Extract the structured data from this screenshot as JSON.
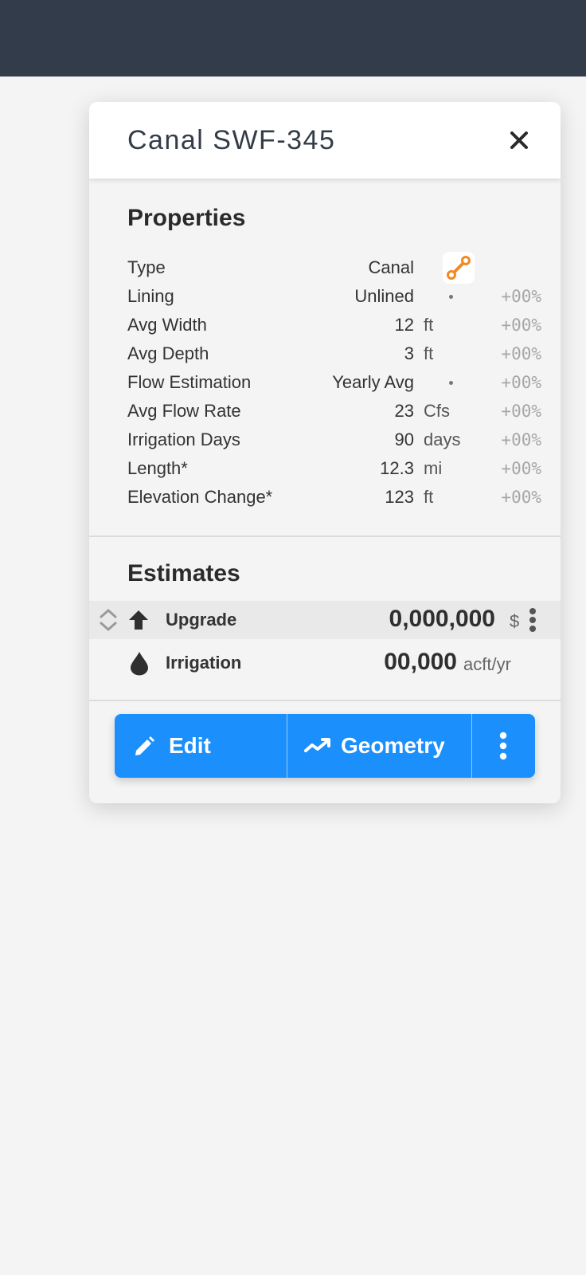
{
  "panel": {
    "title": "Canal SWF-345"
  },
  "properties": {
    "heading": "Properties",
    "rows": [
      {
        "label": "Type",
        "value": "Canal",
        "unit": "",
        "pct": ""
      },
      {
        "label": "Lining",
        "value": "Unlined",
        "unit": "",
        "pct": "+00%"
      },
      {
        "label": "Avg Width",
        "value": "12",
        "unit": "ft",
        "pct": "+00%"
      },
      {
        "label": "Avg Depth",
        "value": "3",
        "unit": "ft",
        "pct": "+00%"
      },
      {
        "label": "Flow Estimation",
        "value": "Yearly Avg",
        "unit": "",
        "pct": "+00%"
      },
      {
        "label": "Avg Flow Rate",
        "value": "23",
        "unit": "Cfs",
        "pct": "+00%"
      },
      {
        "label": "Irrigation Days",
        "value": "90",
        "unit": "days",
        "pct": "+00%"
      },
      {
        "label": "Length*",
        "value": "12.3",
        "unit": "mi",
        "pct": "+00%"
      },
      {
        "label": "Elevation Change*",
        "value": "123",
        "unit": "ft",
        "pct": "+00%"
      }
    ],
    "type_icon": "canal-line-icon",
    "type_icon_color": "#f28a24"
  },
  "estimates": {
    "heading": "Estimates",
    "upgrade": {
      "label": "Upgrade",
      "value": "0,000,000",
      "unit": "$",
      "icon": "arrow-up-icon"
    },
    "irrigation": {
      "label": "Irrigation",
      "value": "00,000",
      "unit": "acft/yr",
      "icon": "water-drop-icon"
    }
  },
  "actions": {
    "edit_label": "Edit",
    "geometry_label": "Geometry"
  },
  "colors": {
    "topbar": "#323c4a",
    "accent": "#1b8ffc",
    "orange": "#f28a24"
  }
}
